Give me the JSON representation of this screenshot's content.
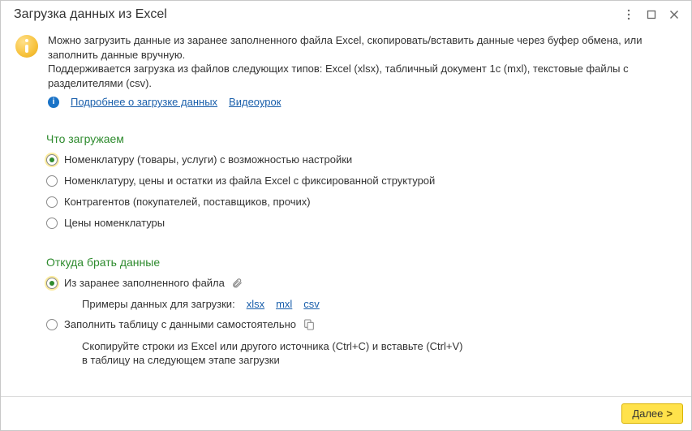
{
  "window": {
    "title": "Загрузка данных из Excel"
  },
  "info": {
    "line1": "Можно загрузить данные из заранее заполненного файла Excel, скопировать/вставить данные через буфер обмена, или заполнить данные вручную.",
    "line2": "Поддерживается загрузка из файлов следующих типов: Excel (xlsx), табличный документ 1с (mxl), текстовые файлы с разделителями (csv).",
    "link_more": "Подробнее о загрузке данных",
    "link_video": "Видеоурок"
  },
  "what": {
    "title": "Что загружаем",
    "options": [
      {
        "label": "Номенклатуру (товары, услуги) с возможностью настройки",
        "selected": true
      },
      {
        "label": "Номенклатуру, цены и остатки из файла Excel с фиксированной структурой",
        "selected": false
      },
      {
        "label": "Контрагентов (покупателей, поставщиков, прочих)",
        "selected": false
      },
      {
        "label": "Цены номенклатуры",
        "selected": false
      }
    ]
  },
  "where": {
    "title": "Откуда брать данные",
    "opt_file": "Из заранее заполненного файла",
    "samples_label": "Примеры данных для загрузки:",
    "samples": {
      "xlsx": "xlsx",
      "mxl": "mxl",
      "csv": "csv"
    },
    "opt_manual": "Заполнить таблицу с данными самостоятельно",
    "hint1": "Скопируйте строки из Excel или другого источника (Ctrl+C) и вставьте (Ctrl+V)",
    "hint2": "в таблицу на следующем этапе загрузки"
  },
  "footer": {
    "next": "Далее"
  }
}
